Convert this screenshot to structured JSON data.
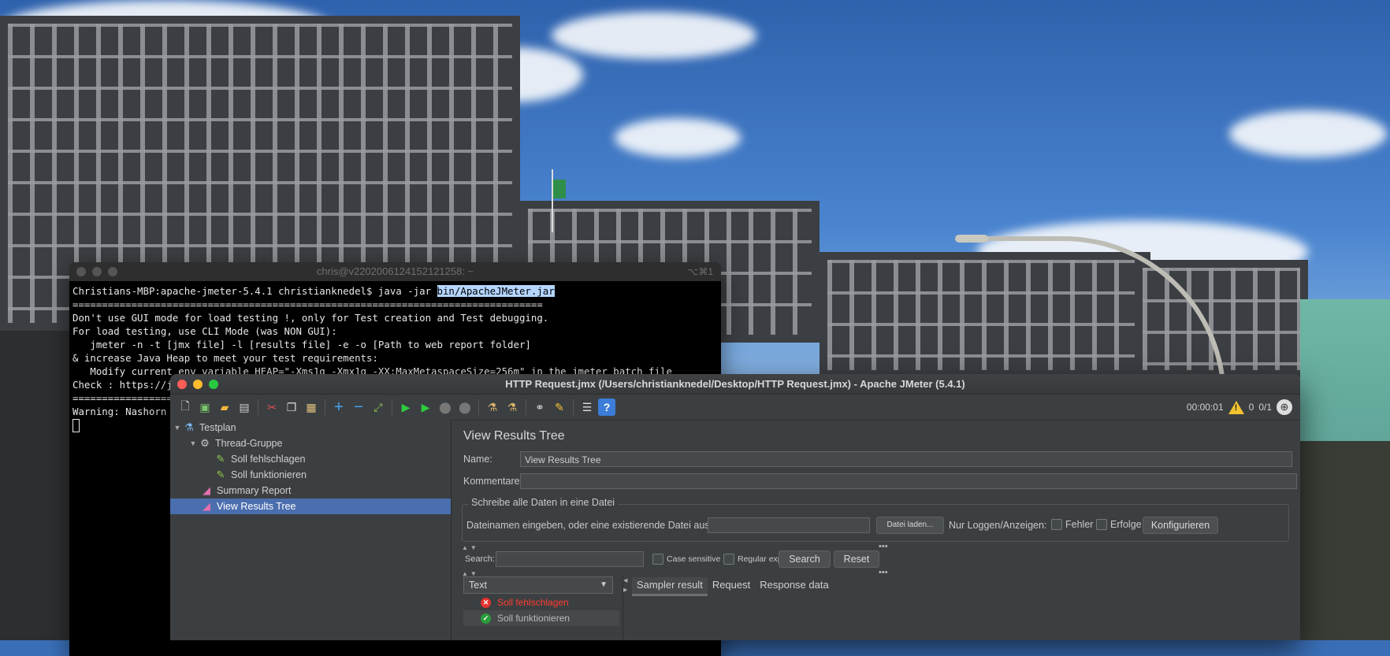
{
  "terminal": {
    "title": "chris@v2202006124152121258: ~",
    "shortcut": "⌥⌘1",
    "prompt": "Christians-MBP:apache-jmeter-5.4.1 christianknedel$ java -jar ",
    "selected_arg": "bin/ApacheJMeter.jar",
    "rule": "================================================================================",
    "lines": [
      "Don't use GUI mode for load testing !, only for Test creation and Test debugging.",
      "For load testing, use CLI Mode (was NON GUI):",
      "   jmeter -n -t [jmx file] -l [results file] -e -o [Path to web report folder]",
      "& increase Java Heap to meet your test requirements:",
      "   Modify current env variable HEAP=\"-Xms1g -Xmx1g -XX:MaxMetaspaceSize=256m\" in the jmeter batch file",
      "Check : https://jmeter.apache.org/usermanual/best-practices.html"
    ],
    "warning": "Warning: Nashorn engine is planned to be removed from a future JDK release"
  },
  "jmeter": {
    "title": "HTTP Request.jmx (/Users/christianknedel/Desktop/HTTP Request.jmx) - Apache JMeter (5.4.1)",
    "toolbar_icons": [
      "new-icon",
      "templates-icon",
      "open-icon",
      "save-icon",
      "cut-icon",
      "copy-icon",
      "paste-icon",
      "expand-icon",
      "collapse-icon",
      "toggle-icon",
      "start-icon",
      "start-no-pauses-icon",
      "stop-icon",
      "shutdown-icon",
      "clear-icon",
      "clear-all-icon",
      "search-icon",
      "reset-search-icon",
      "function-helper-icon",
      "help-icon"
    ],
    "elapsed": "00:00:01",
    "warnings_count": "0",
    "threads": "0/1",
    "tree": [
      {
        "label": "Testplan",
        "icon": "flask-icon",
        "level": 0
      },
      {
        "label": "Thread-Gruppe",
        "icon": "gear-icon",
        "level": 1
      },
      {
        "label": "Soll fehlschlagen",
        "icon": "pipette-icon",
        "level": 2
      },
      {
        "label": "Soll funktionieren",
        "icon": "pipette-icon",
        "level": 2
      },
      {
        "label": "Summary Report",
        "icon": "chart-icon",
        "level": 1
      },
      {
        "label": "View Results Tree",
        "icon": "chart-icon",
        "level": 1,
        "selected": true
      }
    ],
    "panel": {
      "title": "View Results Tree",
      "name_label": "Name:",
      "name_value": "View Results Tree",
      "comments_label": "Kommentare:",
      "comments_value": "",
      "write_section": "Schreibe alle Daten in eine Datei",
      "filename_label": "Dateinamen eingeben, oder eine existierende Datei auswählen.",
      "filename_value": "",
      "browse_button": "Datei laden...",
      "log_only_label": "Nur Loggen/Anzeigen:",
      "errors_label": "Fehler",
      "success_label": "Erfolge",
      "configure_button": "Konfigurieren",
      "search_label": "Search:",
      "search_value": "",
      "case_sensitive_label": "Case sensitive",
      "regex_label": "Regular exp.",
      "search_button": "Search",
      "reset_button": "Reset",
      "renderer": "Text",
      "results": [
        {
          "label": "Soll fehlschlagen",
          "status": "failed"
        },
        {
          "label": "Soll funktionieren",
          "status": "success"
        }
      ],
      "tabs": [
        "Sampler result",
        "Request",
        "Response data"
      ]
    }
  },
  "colors": {
    "selection": "#4b6eaf",
    "window_bg": "#3c3f41",
    "fail": "#ff3b30",
    "success": "#2ecc40"
  }
}
